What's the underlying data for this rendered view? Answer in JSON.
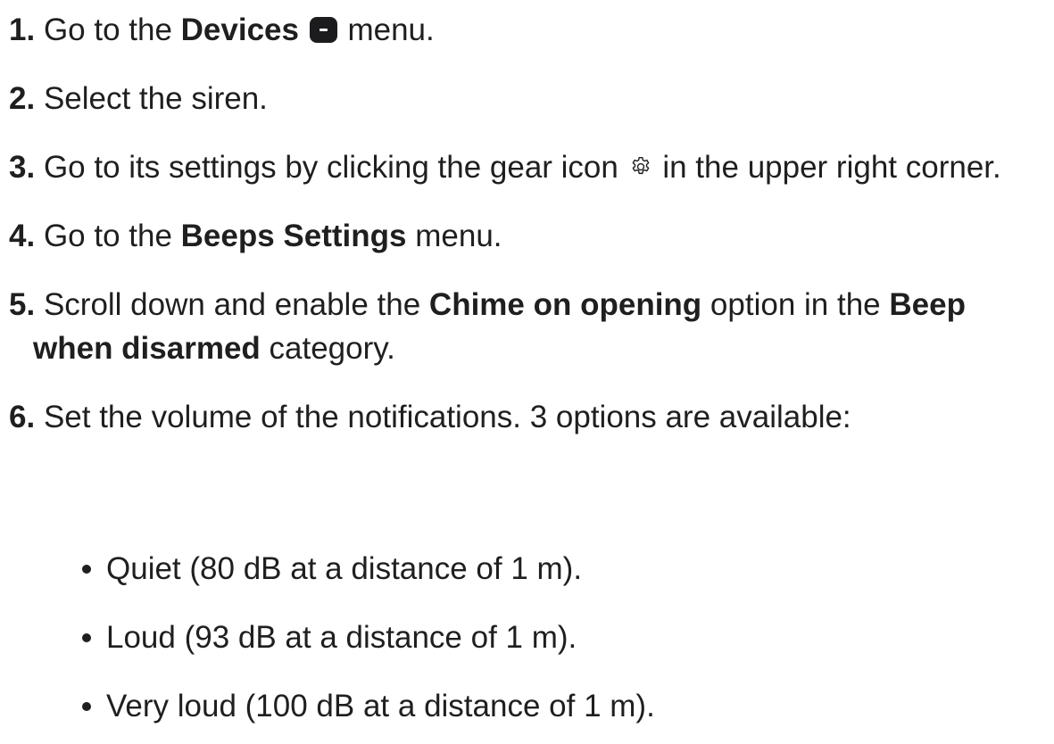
{
  "steps": [
    {
      "num": "1.",
      "pre": "Go to the",
      "bold": "Devices",
      "post": "menu.",
      "icon": "devices-icon"
    },
    {
      "num": "2.",
      "text": "Select the siren."
    },
    {
      "num": "3.",
      "pre": "Go to its settings by clicking the gear icon",
      "post": "in the upper right corner.",
      "icon": "gear-icon"
    },
    {
      "num": "4.",
      "pre": "Go to the",
      "bold": "Beeps Settings",
      "post": "menu."
    },
    {
      "num": "5.",
      "pre": "Scroll down and enable the",
      "bold1": "Chime on opening",
      "mid": "option in the",
      "bold2": "Beep when disarmed",
      "post": "category."
    },
    {
      "num": "6.",
      "text": "Set the volume of the notifications. 3 options are available:"
    }
  ],
  "options": [
    "Quiet (80 dB at a distance of 1 m).",
    "Loud (93 dB at a distance of 1 m).",
    "Very loud (100 dB at a distance of 1 m)."
  ]
}
